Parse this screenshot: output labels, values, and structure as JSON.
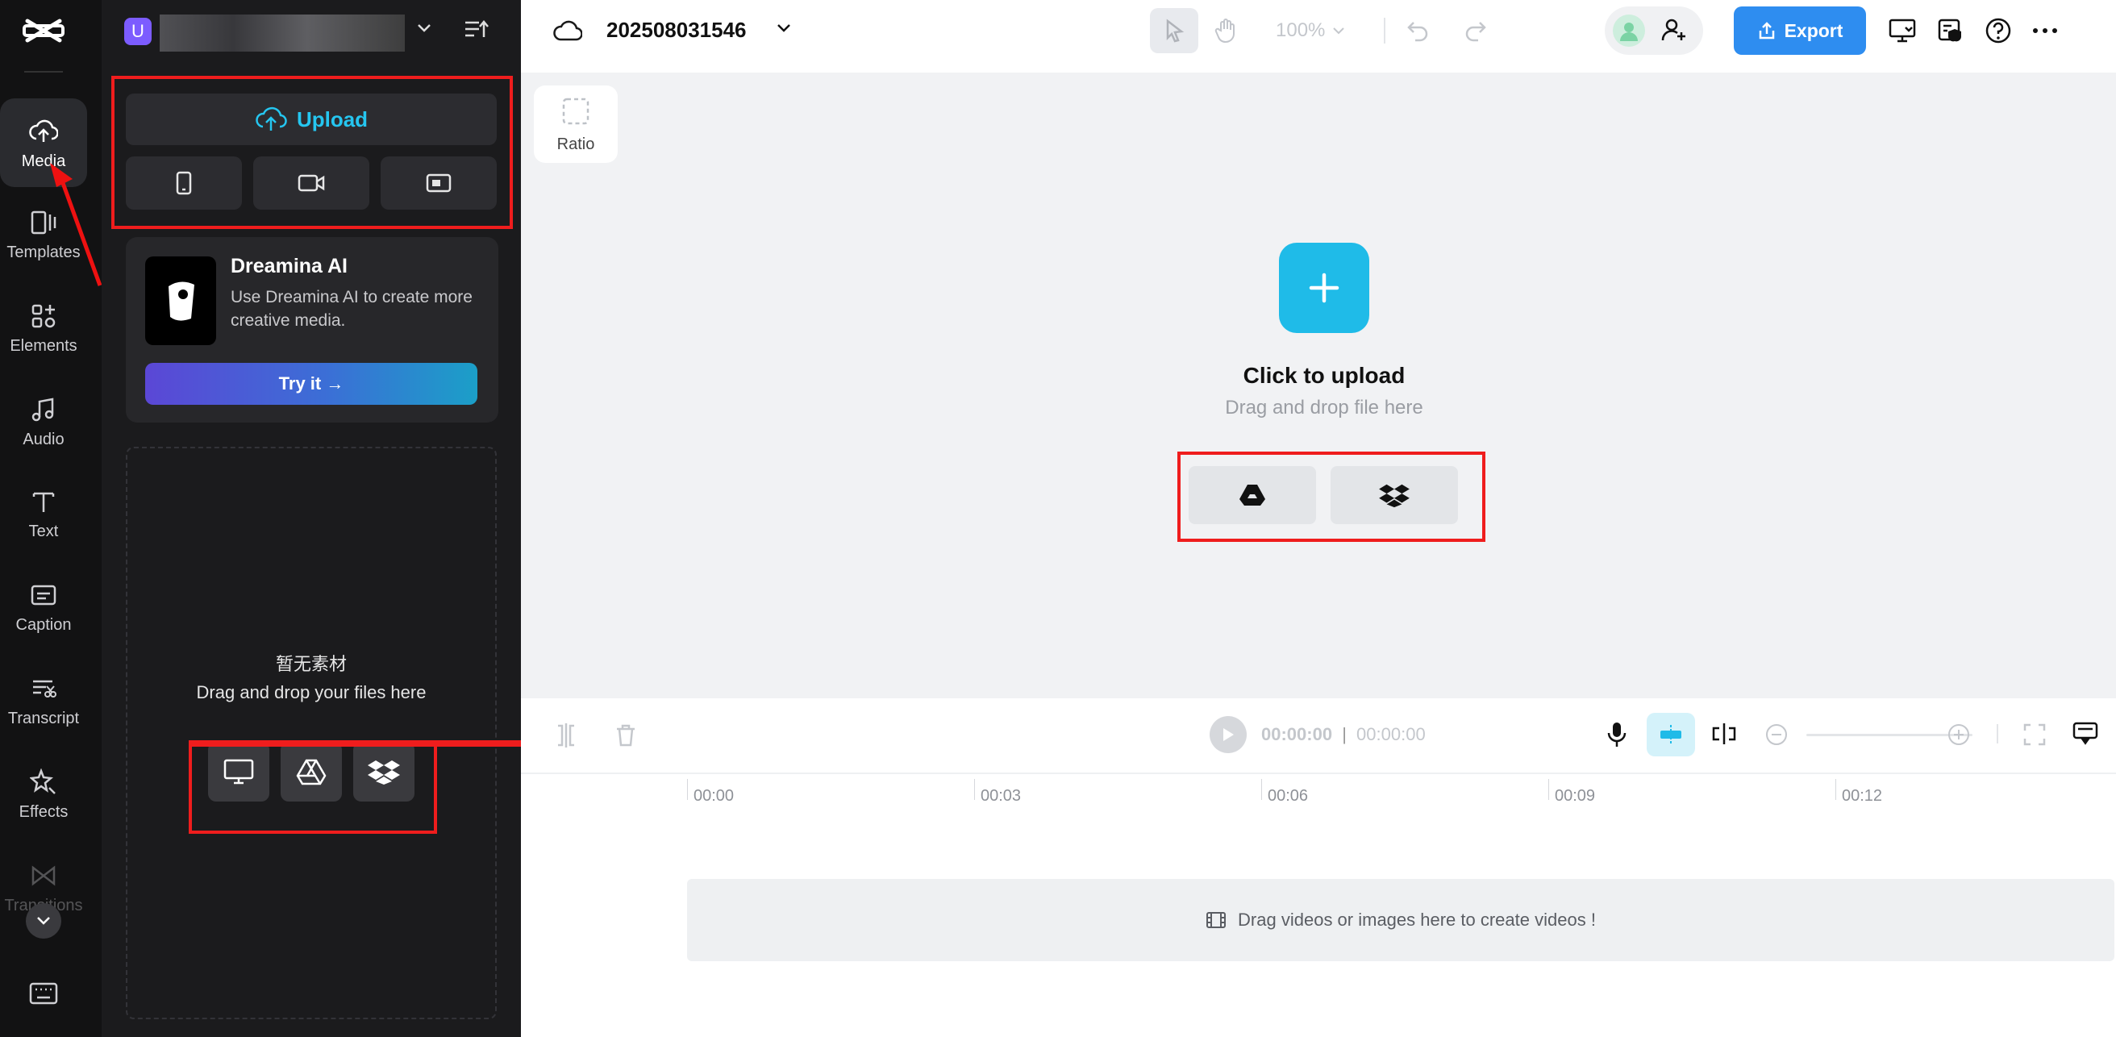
{
  "rail": {
    "items": [
      {
        "label": "Media",
        "icon": "cloud-upload-icon"
      },
      {
        "label": "Templates",
        "icon": "templates-icon"
      },
      {
        "label": "Elements",
        "icon": "elements-icon"
      },
      {
        "label": "Audio",
        "icon": "music-note-icon"
      },
      {
        "label": "Text",
        "icon": "text-icon"
      },
      {
        "label": "Caption",
        "icon": "caption-icon"
      },
      {
        "label": "Transcript",
        "icon": "transcript-icon"
      },
      {
        "label": "Effects",
        "icon": "effects-icon"
      },
      {
        "label": "Transitions",
        "icon": "transitions-icon"
      }
    ]
  },
  "workspace": {
    "avatar_letter": "U"
  },
  "upload": {
    "label": "Upload"
  },
  "dreamina": {
    "title": "Dreamina AI",
    "description": "Use Dreamina AI to create more creative media.",
    "cta": "Try it →"
  },
  "media_empty": {
    "title": "暂无素材",
    "subtitle": "Drag and drop your files here"
  },
  "project": {
    "name": "202508031546"
  },
  "toolbar": {
    "zoom": "100%",
    "export_label": "Export"
  },
  "canvas": {
    "ratio_label": "Ratio",
    "upload_title": "Click to upload",
    "upload_subtitle": "Drag and drop file here"
  },
  "timeline": {
    "current_time": "00:00:00",
    "separator": "|",
    "total_time": "00:00:00",
    "ruler": [
      "00:00",
      "00:03",
      "00:06",
      "00:09",
      "00:12"
    ],
    "drop_hint": "Drag videos or images here to create videos !"
  },
  "colors": {
    "accent": "#1fbbe8",
    "export": "#2e8df0",
    "highlight": "#ef1d1d"
  }
}
